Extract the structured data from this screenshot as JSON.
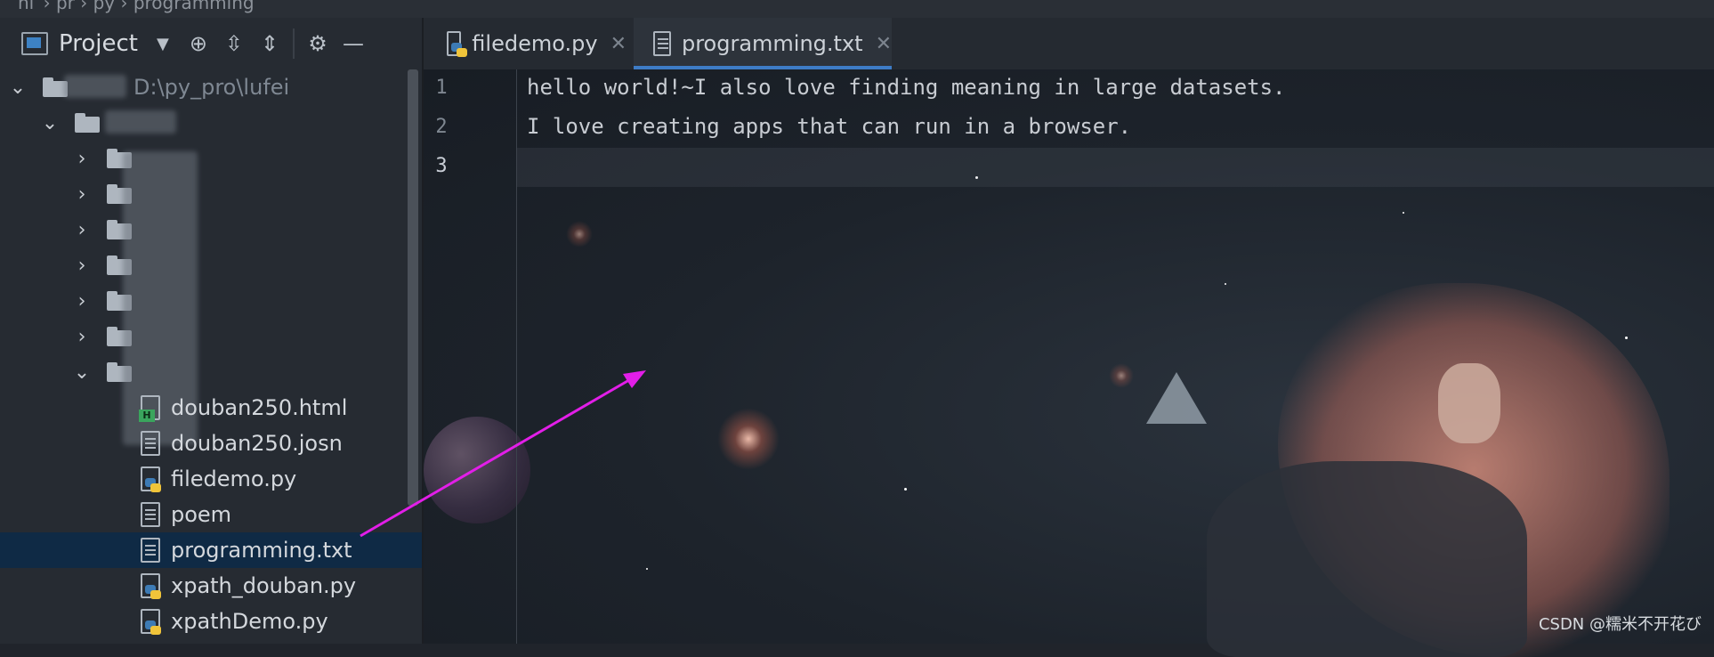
{
  "breadcrumb": "ni  ›  pr  ›  py  ›  programming",
  "project_panel": {
    "title": "Project",
    "root_path": "D:\\py_pro\\lufei",
    "files": [
      {
        "name": "douban250.html",
        "icon": "html-file-icon"
      },
      {
        "name": "douban250.josn",
        "icon": "text-file-icon"
      },
      {
        "name": "filedemo.py",
        "icon": "python-file-icon"
      },
      {
        "name": "poem",
        "icon": "text-file-icon"
      },
      {
        "name": "programming.txt",
        "icon": "text-file-icon"
      },
      {
        "name": "xpath_douban.py",
        "icon": "python-file-icon"
      },
      {
        "name": "xpathDemo.py",
        "icon": "python-file-icon"
      }
    ],
    "selected_file": "programming.txt"
  },
  "tabs": [
    {
      "label": "filedemo.py",
      "icon": "python-file-icon",
      "active": false
    },
    {
      "label": "programming.txt",
      "icon": "text-file-icon",
      "active": true
    }
  ],
  "editor": {
    "line_numbers": [
      "1",
      "2",
      "3"
    ],
    "lines": [
      "hello world!~I also love finding meaning in large datasets.",
      "I love creating apps that can run in a browser.",
      ""
    ]
  },
  "watermark": "CSDN @糯米不开花び",
  "colors": {
    "accent": "#3e7cc6",
    "selection": "#0f2a45",
    "annotation_arrow": "#e21ee8"
  }
}
